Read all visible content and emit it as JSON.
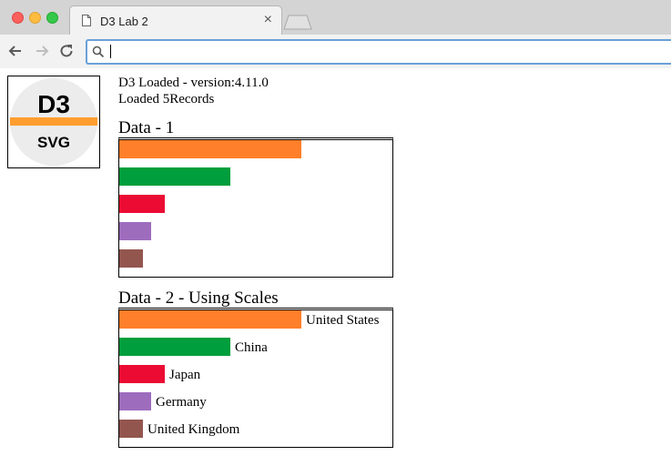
{
  "browser": {
    "tab_title": "D3 Lab 2",
    "tab_close": "×",
    "address_value": "",
    "icons": [
      "document-icon",
      "back-arrow-icon",
      "forward-arrow-icon",
      "reload-icon",
      "search-icon"
    ]
  },
  "logo": {
    "top_text": "D3",
    "bottom_text": "SVG",
    "band_color": "#ff9d2f"
  },
  "status": {
    "line1": "D3 Loaded - version:4.11.0",
    "line2": "Loaded 5Records"
  },
  "sections": [
    {
      "title": "Data - 1"
    },
    {
      "title": "Data - 2 - Using Scales"
    }
  ],
  "chart_data": [
    {
      "type": "bar",
      "orientation": "horizontal",
      "categories": [
        "United States",
        "China",
        "Japan",
        "Germany",
        "United Kingdom"
      ],
      "values": [
        200,
        122,
        50,
        35,
        26
      ],
      "colors": [
        "#ff7f2a",
        "#009e3c",
        "#eb0b33",
        "#9e6cbd",
        "#93564f"
      ],
      "show_labels": false
    },
    {
      "type": "bar",
      "orientation": "horizontal",
      "categories": [
        "United States",
        "China",
        "Japan",
        "Germany",
        "United Kingdom"
      ],
      "values": [
        200,
        122,
        50,
        35,
        26
      ],
      "colors": [
        "#ff7f2a",
        "#009e3c",
        "#eb0b33",
        "#9e6cbd",
        "#93564f"
      ],
      "show_labels": true
    }
  ]
}
